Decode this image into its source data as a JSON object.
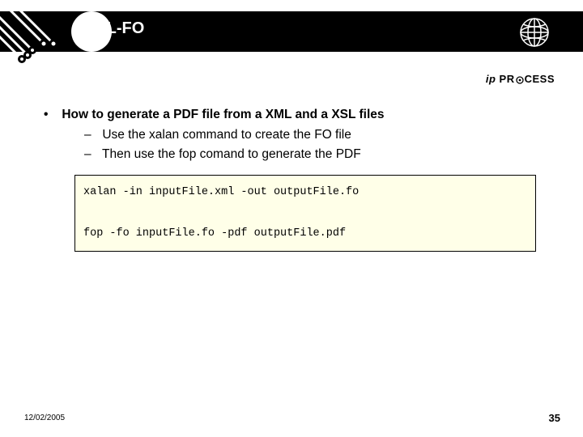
{
  "header": {
    "title": "XSL-FO"
  },
  "brand": {
    "text": "ipPROCESS"
  },
  "content": {
    "main_bullet": "How to generate a PDF file from a XML and a XSL files",
    "sub_bullets": [
      "Use the xalan command to create the FO file",
      "Then use the fop comand to generate the PDF"
    ],
    "code": "xalan -in inputFile.xml -out outputFile.fo\n\nfop -fo inputFile.fo -pdf outputFile.pdf"
  },
  "footer": {
    "date": "12/02/2005",
    "page": "35"
  }
}
